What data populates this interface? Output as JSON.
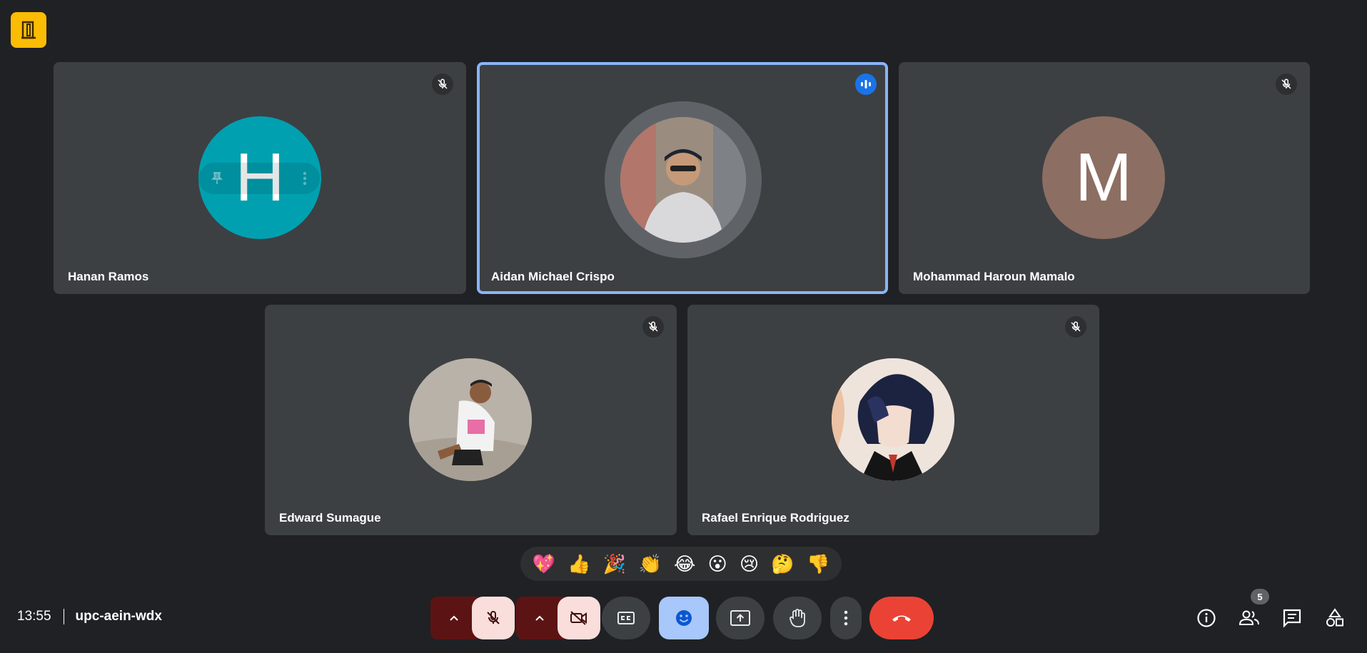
{
  "app": {
    "room_icon": "door-icon",
    "accent": "#fbbc04"
  },
  "participants": [
    {
      "name": "Hanan Ramos",
      "initial": "H",
      "avatar_color": "#00a0b0",
      "muted": true
    },
    {
      "name": "Aidan Michael Crispo",
      "speaking": true,
      "avatar": "photo"
    },
    {
      "name": "Mohammad Haroun Mamalo",
      "initial": "M",
      "avatar_color": "#8d6e63",
      "muted": true
    },
    {
      "name": "Edward Sumague",
      "avatar": "photo",
      "muted": true
    },
    {
      "name": "Rafael Enrique Rodriguez",
      "avatar": "photo",
      "muted": true
    }
  ],
  "reactions": [
    "💖",
    "👍",
    "🎉",
    "👏",
    "😂",
    "😮",
    "😢",
    "🤔",
    "👎"
  ],
  "footer": {
    "time": "13:55",
    "meeting_code": "upc-aein-wdx",
    "participant_count": "5"
  },
  "controls": {
    "mic": "mic-off-icon",
    "camera": "camera-off-icon",
    "captions": "captions-icon",
    "emoji": "emoji-icon",
    "present": "present-icon",
    "raise_hand": "hand-icon",
    "more": "more-vert-icon",
    "end_call": "end-call-icon",
    "end_color": "#ea4335"
  }
}
